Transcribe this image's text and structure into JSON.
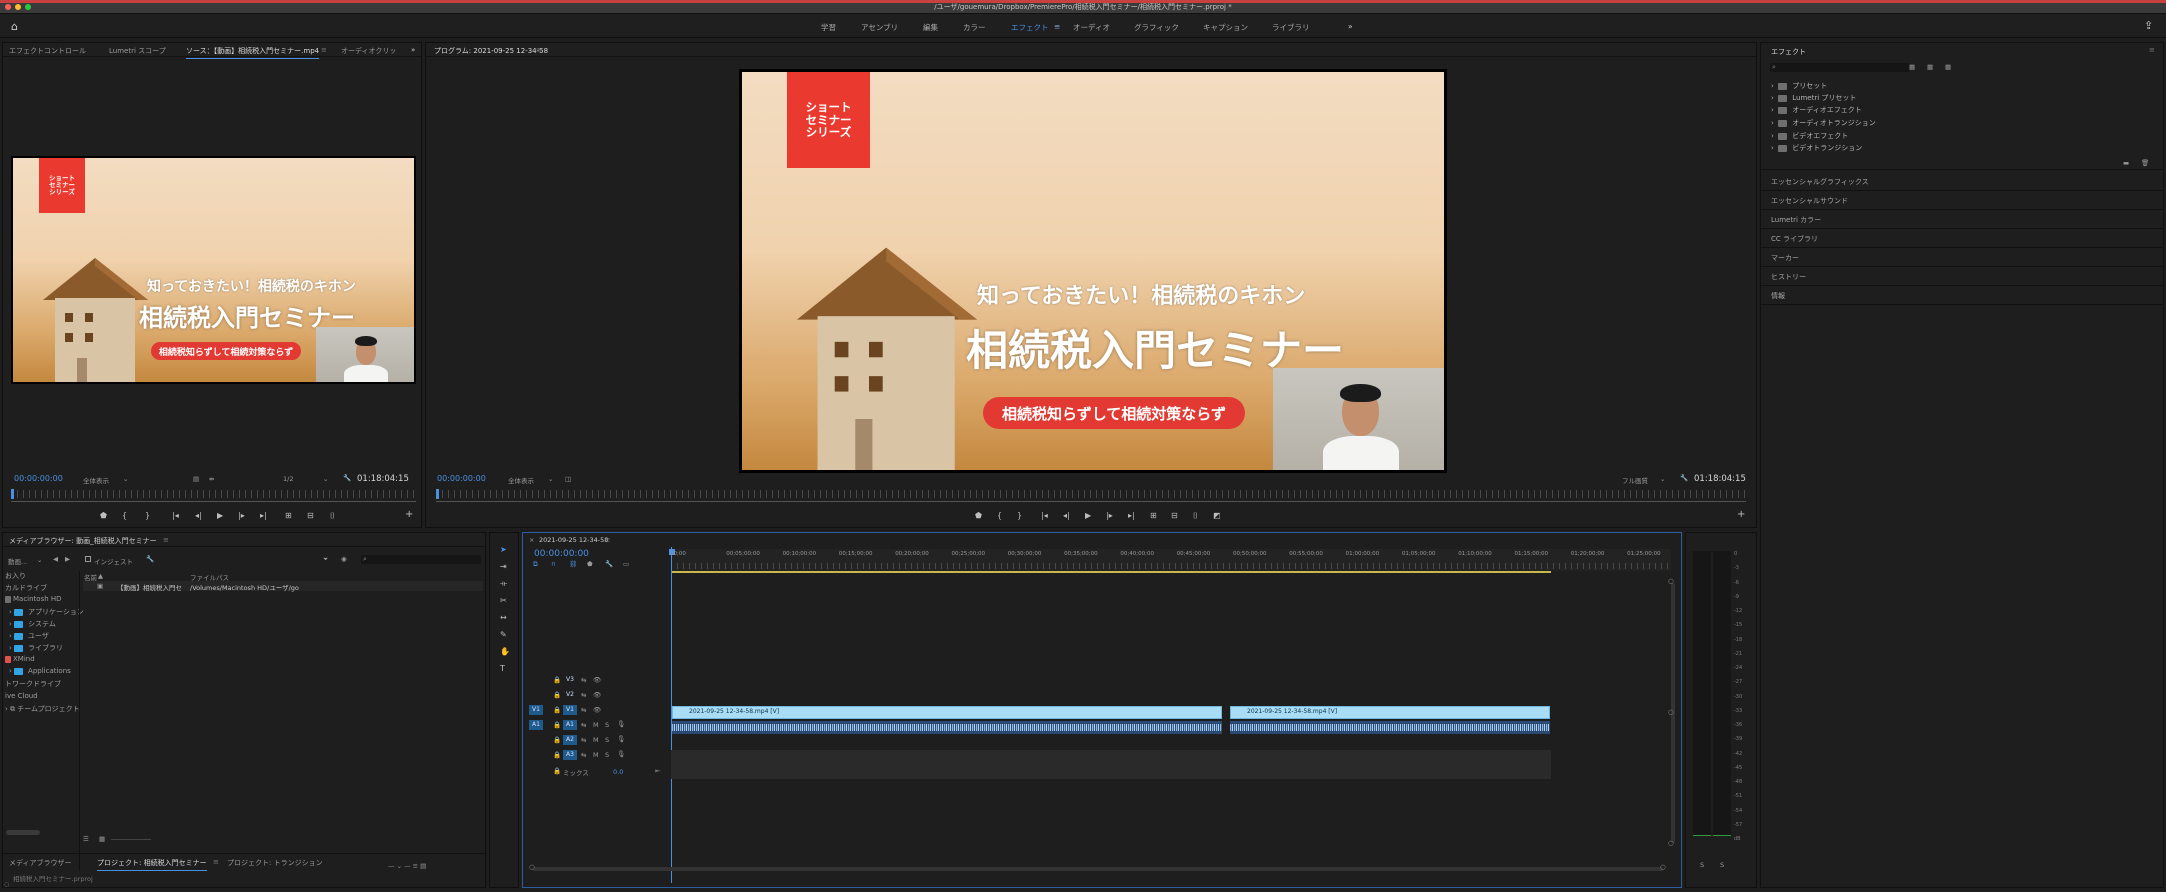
{
  "window": {
    "title": "/ユーザ/gouemura/Dropbox/PremierePro/相続税入門セミナー/相続税入門セミナー.prproj *"
  },
  "workspaces": {
    "items": [
      "学習",
      "アセンブリ",
      "編集",
      "カラー",
      "エフェクト",
      "オーディオ",
      "グラフィック",
      "キャプション",
      "ライブラリ"
    ],
    "active": "エフェクト",
    "more": "»"
  },
  "source_panel": {
    "tabs": [
      "エフェクトコントロール",
      "Lumetri スコープ",
      "ソース：【動画】相続税入門セミナー.mp4",
      "オーディオクリッ"
    ],
    "active_tab": 2,
    "timecode": "00:00:00:00",
    "fit": "全体表示",
    "resolution": "1/2",
    "duration": "01:18:04:15",
    "more": "»"
  },
  "program_panel": {
    "tab": "プログラム: 2021-09-25 12-34-58",
    "timecode": "00:00:00:00",
    "fit": "全体表示",
    "quality": "フル画質",
    "duration": "01:18:04:15"
  },
  "video_frame": {
    "logo": "ショート\nセミナー\nシリーズ",
    "subtitle": "知っておきたい！相続税のキホン",
    "title": "相続税入門セミナー",
    "pill": "相続税知らずして相続対策ならず",
    "colors": {
      "logo": "#ea3a2f",
      "pill": "#e23a33"
    }
  },
  "effects_panel": {
    "title": "エフェクト",
    "search_icon": "search-icon",
    "tree": [
      "プリセット",
      "Lumetri プリセット",
      "オーディオエフェクト",
      "オーディオトランジション",
      "ビデオエフェクト",
      "ビデオトランジション"
    ],
    "sections": [
      "エッセンシャルグラフィックス",
      "エッセンシャルサウンド",
      "Lumetri カラー",
      "CC ライブラリ",
      "マーカー",
      "ヒストリー",
      "情報"
    ]
  },
  "media_browser": {
    "tab": "メディアブラウザー: 動画_相続税入門セミナー",
    "filter": "動画...",
    "ingest": "インジェスト",
    "col_name": "名前",
    "col_path": "ファイルパス",
    "file_name": "【動画】相続税入門セ",
    "file_path": "/Volumes/Macintosh HD/ユーザ/go",
    "sidebar": [
      "お入り",
      "カルドライブ",
      "Macintosh HD",
      "アプリケーション",
      "システム",
      "ユーザ",
      "ライブラリ",
      "XMind",
      "Applications",
      "トワークドライブ",
      "ive Cloud",
      "チームプロジェクト"
    ],
    "bottom_tabs": [
      "メディアブラウザー",
      "プロジェクト: 相続税入門セミナー",
      "プロジェクト: トランジション"
    ],
    "bottom_active": 1,
    "overflow_text": "相続税入門セミナー.prproj"
  },
  "timeline": {
    "tab": "2021-09-25 12-34-58",
    "timecode": "00:00:00:00",
    "ruler": [
      "00;00",
      "00;05;00;00",
      "00;10;00;00",
      "00;15;00;00",
      "00;20;00;00",
      "00;25;00;00",
      "00;30;00;00",
      "00;35;00;00",
      "00;40;00;00",
      "00;45;00;00",
      "00;50;00;00",
      "00;55;00;00",
      "01;00;00;00",
      "01;05;00;00",
      "01;10;00;00",
      "01;15;00;00",
      "01;20;00;00",
      "01;25;00;00"
    ],
    "tracks_video": [
      "V3",
      "V2",
      "V1"
    ],
    "tracks_audio": [
      "A1",
      "A2",
      "A3"
    ],
    "mix_label": "ミックス",
    "mix_value": "0.0",
    "clip1": "2021-09-25 12-34-58.mp4 [V]",
    "clip2": "2021-09-25 12-34-58.mp4 [V]",
    "mute": "M",
    "solo": "S",
    "source_patch_v": "V1",
    "source_patch_a": "A1"
  },
  "meters": {
    "ticks": [
      "0",
      "-3",
      "-6",
      "-9",
      "-12",
      "-15",
      "-18",
      "-21",
      "-24",
      "-27",
      "-30",
      "-33",
      "-36",
      "-39",
      "-42",
      "-45",
      "-48",
      "-51",
      "-54",
      "-57",
      "dB"
    ],
    "solo_left": "S",
    "solo_right": "S"
  }
}
